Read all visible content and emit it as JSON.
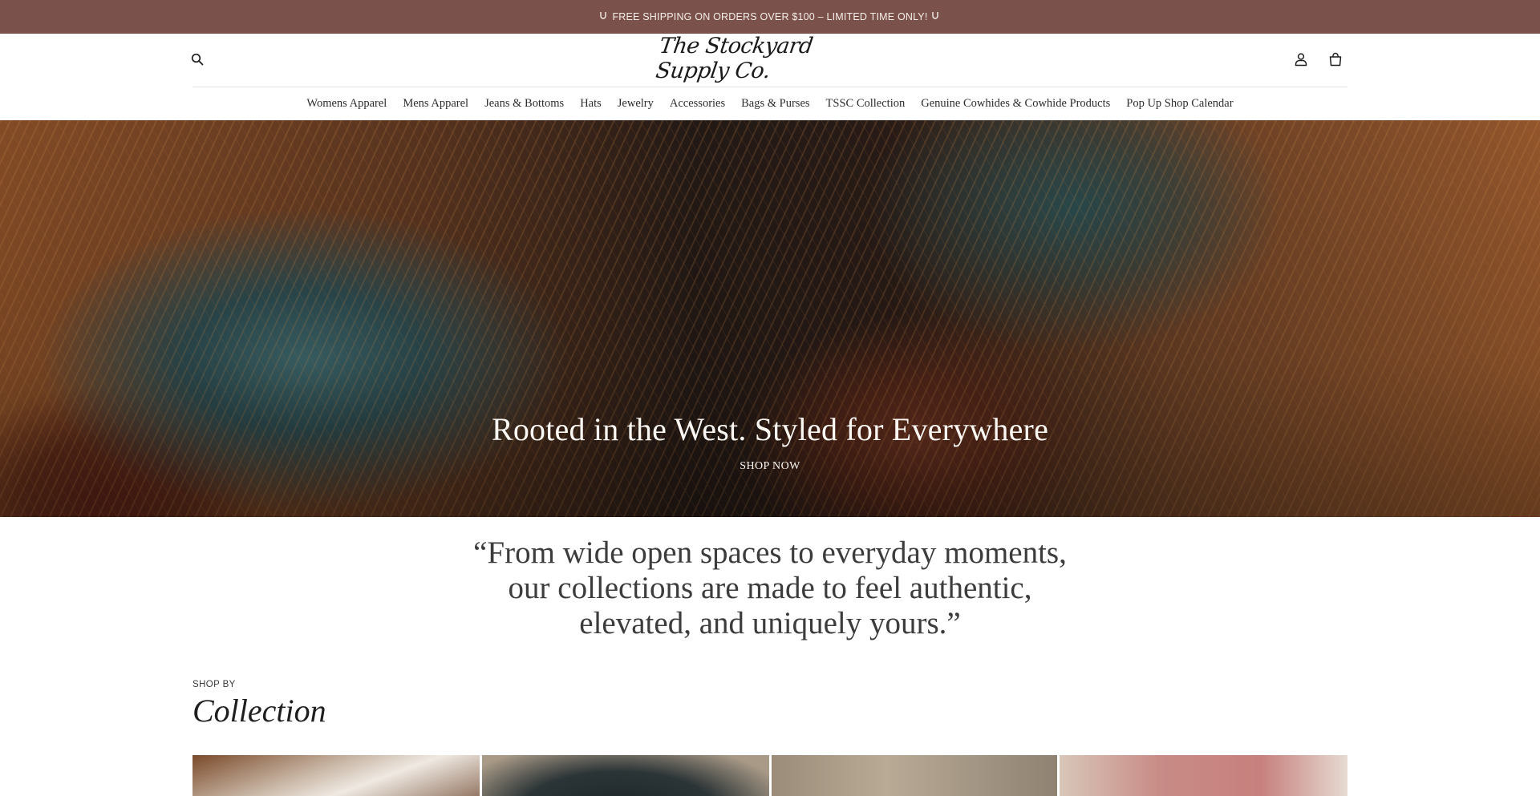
{
  "announcement": {
    "text": "FREE SHIPPING ON ORDERS OVER $100 – LIMITED TIME ONLY!",
    "icon": "horseshoe-icon"
  },
  "header": {
    "logo_text": "The Stockyard Supply Co.",
    "icons": {
      "search": "search-icon",
      "account": "user-icon",
      "cart": "shopping-bag-icon"
    }
  },
  "nav": {
    "items": [
      "Womens Apparel",
      "Mens Apparel",
      "Jeans & Bottoms",
      "Hats",
      "Jewelry",
      "Accessories",
      "Bags & Purses",
      "TSSC Collection",
      "Genuine Cowhides & Cowhide Products",
      "Pop Up Shop Calendar"
    ]
  },
  "hero": {
    "title": "Rooted in the West. Styled for Everywhere",
    "cta": "SHOP NOW"
  },
  "quote": {
    "text": "“From wide open spaces to everyday moments, our collections are made to feel authentic, elevated, and uniquely yours.”"
  },
  "collection": {
    "eyebrow": "SHOP BY",
    "title": "Collection"
  },
  "colors": {
    "announcement_bg": "#7a514b",
    "announcement_text": "#f6efe9",
    "text": "#2d2d2d"
  }
}
